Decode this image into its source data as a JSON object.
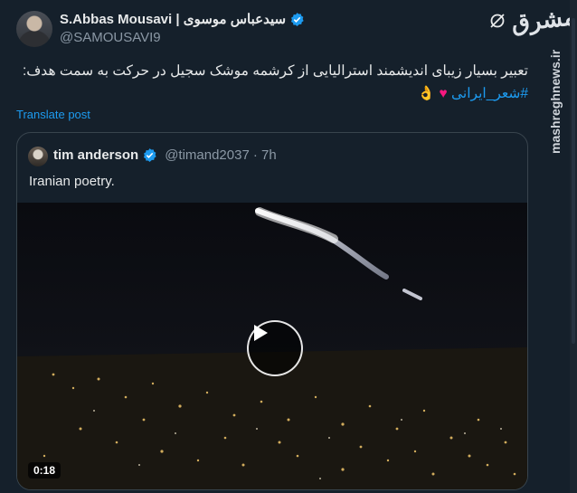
{
  "post": {
    "author_name": "S.Abbas Mousavi | سیدعباس موسوی",
    "handle": "@SAMOUSAVI9",
    "text": "تعبیر بسیار زیبای اندیشمند استرالیایی از کرشمه موشک سجیل در حرکت به سمت هدف:",
    "hashtag": "#شعر_ایرانی",
    "emojis": "♥ 👌",
    "translate_label": "Translate post"
  },
  "quote": {
    "author_name": "tim anderson",
    "handle": "@timand2037",
    "time": "· 7h",
    "text": "Iranian poetry.",
    "video_duration": "0:18"
  },
  "watermark": {
    "logo": "مشرق",
    "side_text": "mashreghnews.ir"
  },
  "colors": {
    "background": "#15202b",
    "accent": "#1d9bf0",
    "heart": "#f91880"
  }
}
